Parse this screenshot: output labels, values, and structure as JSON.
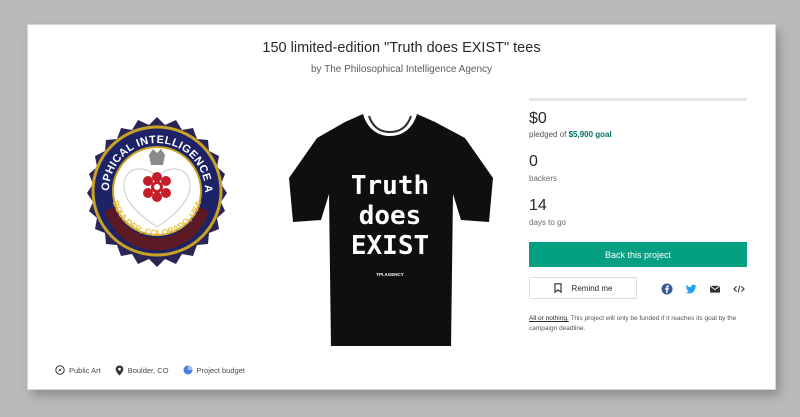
{
  "project": {
    "title": "150 limited-edition \"Truth does EXIST\" tees",
    "byline": "by The Philosophical Intelligence Agency"
  },
  "badge": {
    "text_top": "PHILOSOPHICAL INTELLIGENCE AGENCY",
    "text_bottom": "BOULDER, COLORADO, USA",
    "colors": {
      "outer": "#1d2366",
      "ring": "#c8a227",
      "heart": "#c41e2a",
      "band": "#5c1a24"
    }
  },
  "shirt": {
    "line1": "Truth",
    "line2": "does",
    "line3": "EXIST",
    "tag": "TPI.AGENCY"
  },
  "meta": {
    "category": "Public Art",
    "location": "Boulder, CO",
    "budget": "Project budget"
  },
  "stats": {
    "pledged": "$0",
    "pledged_prefix": "pledged of ",
    "goal": "$5,900 goal",
    "backers": "0",
    "backers_label": "backers",
    "days": "14",
    "days_label": "days to go",
    "progress": 0
  },
  "actions": {
    "back": "Back this project",
    "remind": "Remind me"
  },
  "fine_print": {
    "link": "All or nothing.",
    "text": " This project will only be funded if it reaches its goal by the campaign deadline."
  },
  "colors": {
    "accent": "#05a081",
    "goal": "#037362"
  }
}
